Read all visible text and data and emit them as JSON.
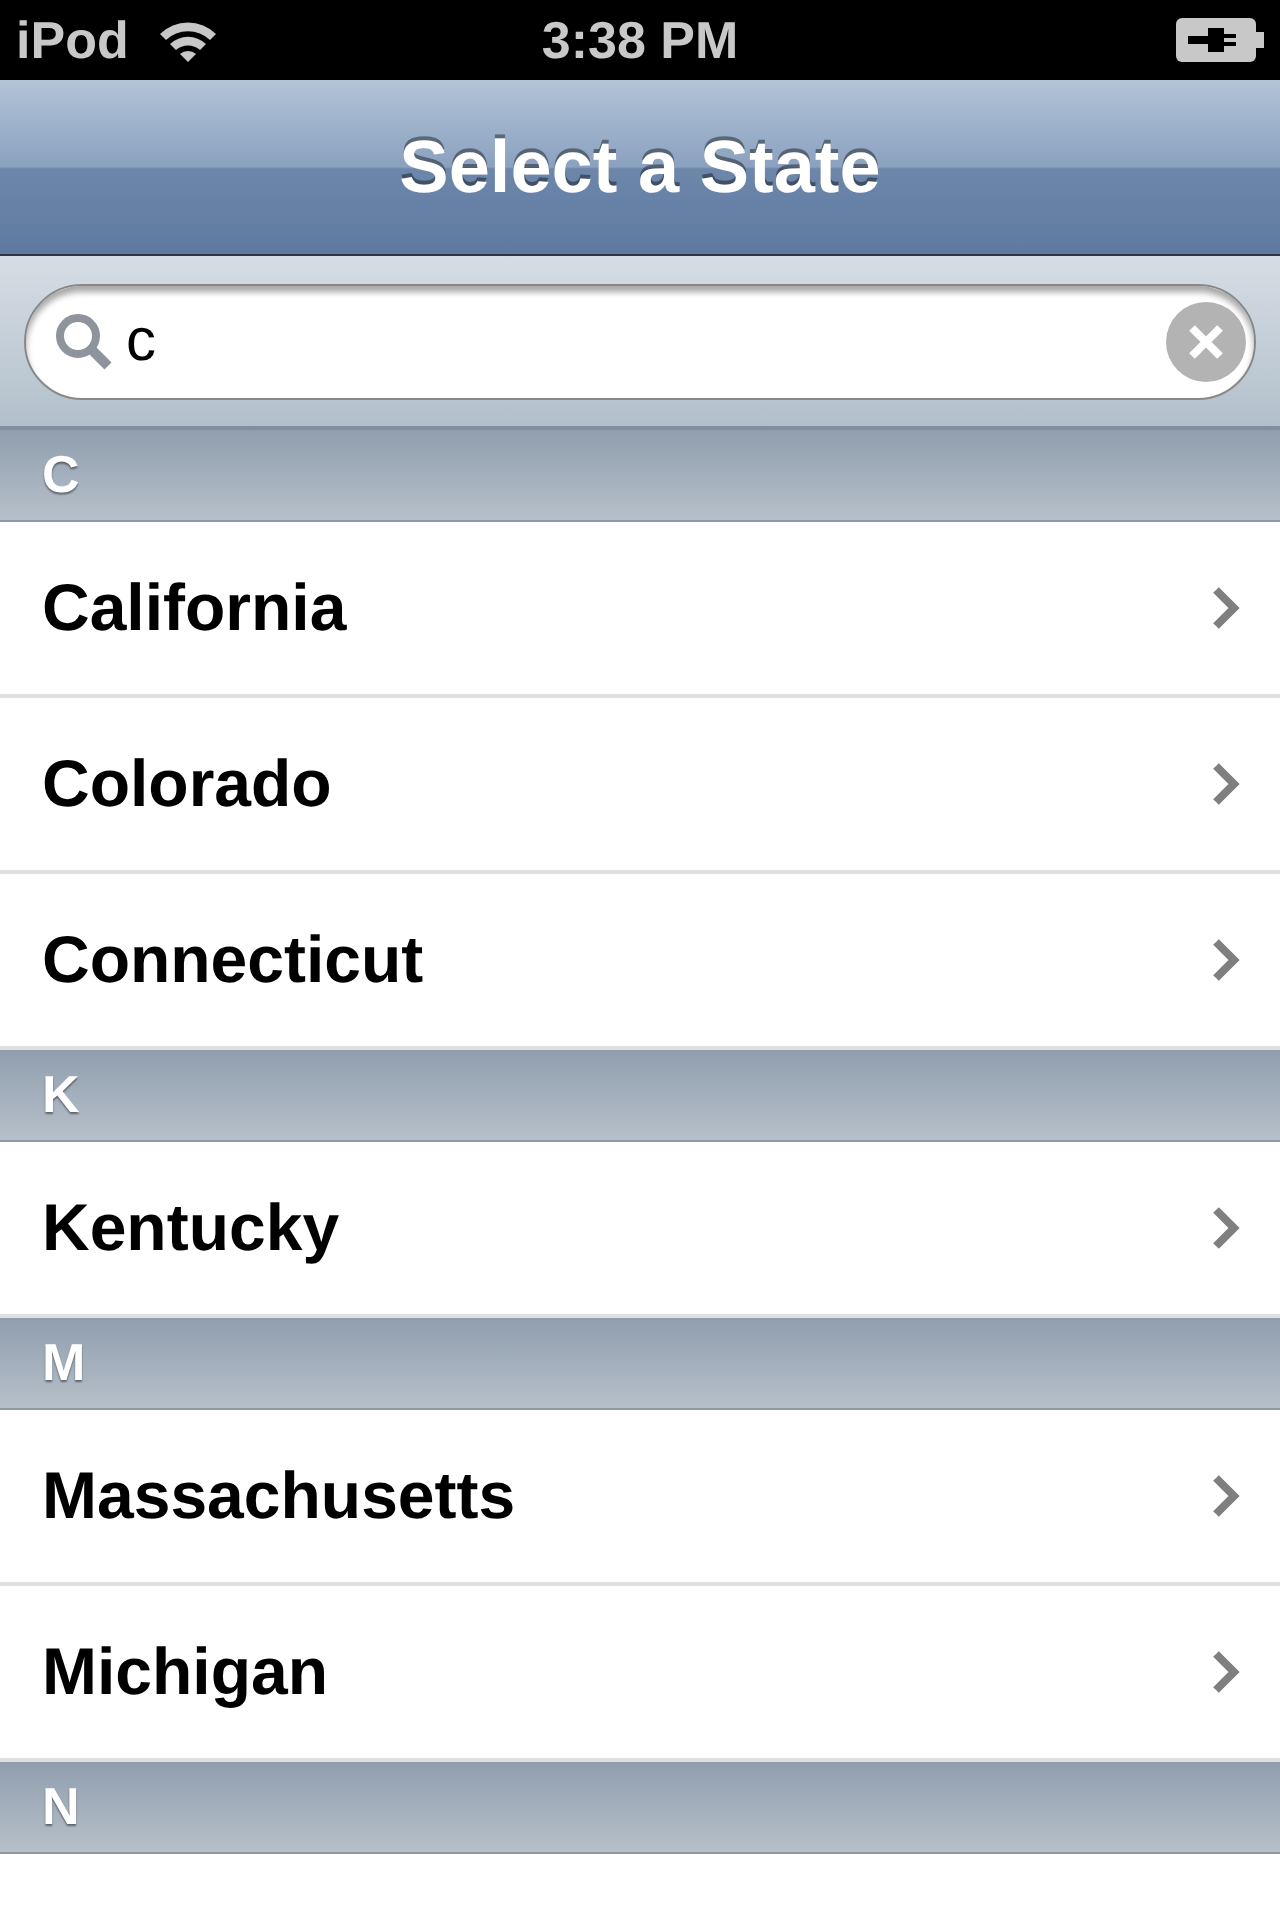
{
  "status_bar": {
    "carrier": "iPod",
    "time": "3:38 PM"
  },
  "nav_bar": {
    "title": "Select a State"
  },
  "search": {
    "value": "c"
  },
  "sections": [
    {
      "letter": "C",
      "rows": [
        {
          "label": "California"
        },
        {
          "label": "Colorado"
        },
        {
          "label": "Connecticut"
        }
      ]
    },
    {
      "letter": "K",
      "rows": [
        {
          "label": "Kentucky"
        }
      ]
    },
    {
      "letter": "M",
      "rows": [
        {
          "label": "Massachusetts"
        },
        {
          "label": "Michigan"
        }
      ]
    },
    {
      "letter": "N"
    }
  ]
}
